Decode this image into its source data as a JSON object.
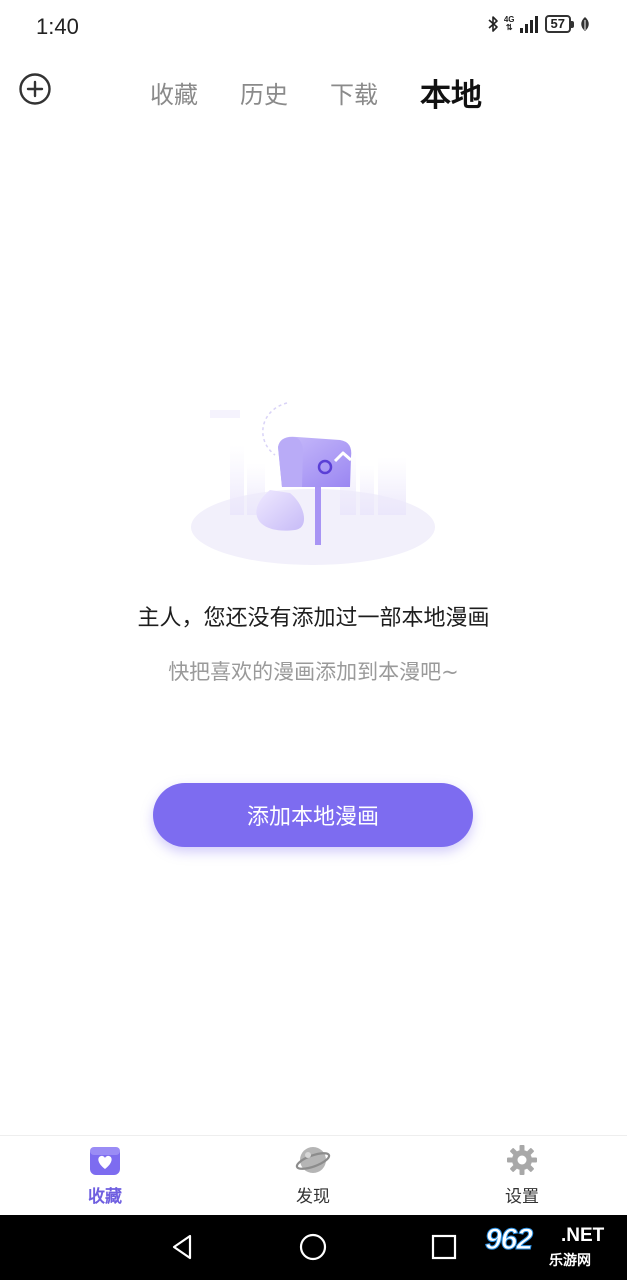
{
  "status_bar": {
    "time": "1:40",
    "network": "4G",
    "battery": "57",
    "icons": [
      "bluetooth-icon",
      "signal-icon",
      "battery-icon",
      "leaf-icon"
    ]
  },
  "top_nav": {
    "add_icon": "plus-circle-icon",
    "tabs": [
      {
        "label": "收藏",
        "active": false
      },
      {
        "label": "历史",
        "active": false
      },
      {
        "label": "下载",
        "active": false
      },
      {
        "label": "本地",
        "active": true
      }
    ]
  },
  "empty_state": {
    "illustration": "mailbox-illustration",
    "title": "主人，您还没有添加过一部本地漫画",
    "subtitle": "快把喜欢的漫画添加到本漫吧~",
    "button_label": "添加本地漫画"
  },
  "bottom_tabs": [
    {
      "label": "收藏",
      "icon": "heart-folder-icon",
      "active": true
    },
    {
      "label": "发现",
      "icon": "planet-icon",
      "active": false
    },
    {
      "label": "设置",
      "icon": "gear-icon",
      "active": false
    }
  ],
  "android_nav": {
    "buttons": [
      "back-icon",
      "home-icon",
      "recents-icon"
    ]
  },
  "watermark": {
    "number": "962",
    "suffix": ".NET",
    "site": "乐游网"
  },
  "colors": {
    "accent": "#7d6cf0",
    "active_tab_text": "#6f5fe0",
    "inactive_tab_text": "#8a8a8a"
  }
}
